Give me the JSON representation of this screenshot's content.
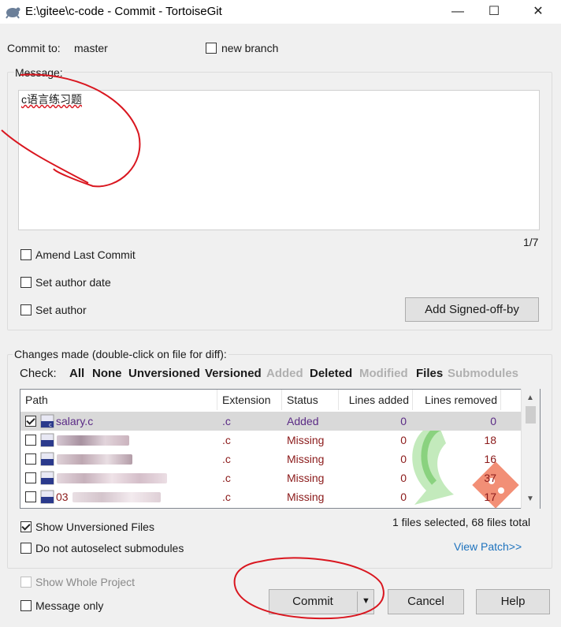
{
  "window": {
    "title": "E:\\gitee\\c-code - Commit - TortoiseGit",
    "minimize": "—",
    "maximize": "☐",
    "close": "✕"
  },
  "commit": {
    "commit_to_label": "Commit to:",
    "branch": "master",
    "new_branch_label": "new branch",
    "message_label": "Message:",
    "message_text": "c语言练习题",
    "line_counter": "1/7",
    "amend_label": "Amend Last Commit",
    "author_date_label": "Set author date",
    "author_label": "Set author",
    "signed_off_label": "Add Signed-off-by"
  },
  "changes": {
    "group_label": "Changes made (double-click on file for diff):",
    "check_label": "Check:",
    "filters": [
      {
        "label": "All",
        "enabled": true
      },
      {
        "label": "None",
        "enabled": true
      },
      {
        "label": "Unversioned",
        "enabled": true
      },
      {
        "label": "Versioned",
        "enabled": true
      },
      {
        "label": "Added",
        "enabled": false
      },
      {
        "label": "Deleted",
        "enabled": true
      },
      {
        "label": "Modified",
        "enabled": false
      },
      {
        "label": "Files",
        "enabled": true
      },
      {
        "label": "Submodules",
        "enabled": false
      }
    ],
    "columns": [
      "Path",
      "Extension",
      "Status",
      "Lines added",
      "Lines removed"
    ],
    "rows": [
      {
        "path": "salary.c",
        "ext": ".c",
        "status": "Added",
        "added": "0",
        "removed": "0",
        "checked": true,
        "selected": true
      },
      {
        "path": "",
        "ext": ".c",
        "status": "Missing",
        "added": "0",
        "removed": "18",
        "checked": false,
        "selected": false
      },
      {
        "path": "",
        "ext": ".c",
        "status": "Missing",
        "added": "0",
        "removed": "16",
        "checked": false,
        "selected": false
      },
      {
        "path": "",
        "ext": ".c",
        "status": "Missing",
        "added": "0",
        "removed": "37",
        "checked": false,
        "selected": false
      },
      {
        "path": "03",
        "ext": ".c",
        "status": "Missing",
        "added": "0",
        "removed": "17",
        "checked": false,
        "selected": false
      }
    ],
    "show_unversioned_label": "Show Unversioned Files",
    "no_autoselect_label": "Do not autoselect submodules",
    "selection_summary": "1 files selected, 68 files total",
    "view_patch_label": "View Patch>>"
  },
  "footer": {
    "show_whole_project_label": "Show Whole Project",
    "message_only_label": "Message only",
    "commit_label": "Commit",
    "cancel_label": "Cancel",
    "help_label": "Help"
  },
  "colors": {
    "added_text": "#5b2b86",
    "missing_text": "#8b1a1a",
    "link": "#1e73be",
    "annotation": "#d9161f"
  }
}
